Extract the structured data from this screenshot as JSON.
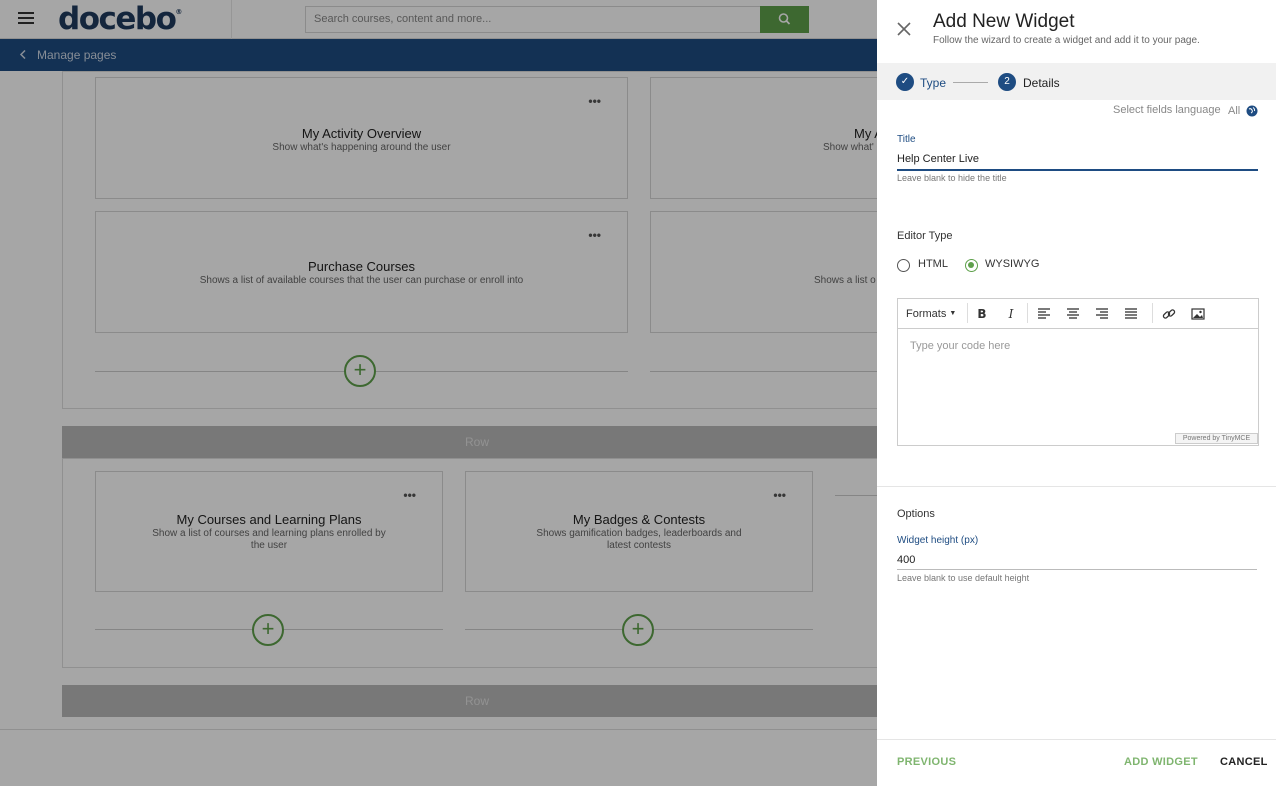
{
  "header": {
    "logo_text": "docebo",
    "logo_mark": "®",
    "search_placeholder": "Search courses, content and more...",
    "search_icon": "search-icon",
    "menu_icon": "hamburger-icon"
  },
  "subbar": {
    "back_label": "Manage pages"
  },
  "background": {
    "widgets_row1": [
      {
        "title": "My Activity Overview",
        "description": "Show what's happening around the user"
      },
      {
        "title": "My A",
        "description": "Show what'"
      },
      {
        "title": "Purchase Courses",
        "description": "Shows a list of available courses that the user can purchase or enroll into"
      },
      {
        "title": "",
        "description": "Shows a list o"
      }
    ],
    "row_label": "Row",
    "widgets_row2": [
      {
        "title": "My Courses and Learning Plans",
        "description": "Show a list of courses and learning plans enrolled by the user"
      },
      {
        "title": "My Badges & Contests",
        "description": "Shows gamification badges, leaderboards and latest contests"
      }
    ],
    "row_label_2": "Row",
    "more_icon": "•••",
    "add_icon": "+"
  },
  "panel": {
    "title": "Add New Widget",
    "subtitle": "Follow the wizard to create a widget and add it to your page.",
    "steps": [
      {
        "number": "✓",
        "label": "Type",
        "state": "done"
      },
      {
        "number": "2",
        "label": "Details",
        "state": "active"
      }
    ],
    "language_label": "Select fields language",
    "language_value": "All",
    "title_field": {
      "label": "Title",
      "value": "Help Center Live",
      "hint": "Leave blank to hide the title"
    },
    "editor_type": {
      "label": "Editor Type",
      "options": [
        "HTML",
        "WYSIWYG"
      ],
      "selected": "WYSIWYG"
    },
    "editor": {
      "formats_label": "Formats",
      "placeholder": "Type your code here",
      "powered_by": "Powered by TinyMCE"
    },
    "options": {
      "label": "Options",
      "height_label": "Widget height (px)",
      "height_value": "400",
      "height_hint": "Leave blank to use default height"
    },
    "footer": {
      "previous": "PREVIOUS",
      "add": "ADD WIDGET",
      "cancel": "CANCEL"
    }
  },
  "colors": {
    "brand_blue": "#1e4c82",
    "accent_green": "#5ea04b"
  }
}
